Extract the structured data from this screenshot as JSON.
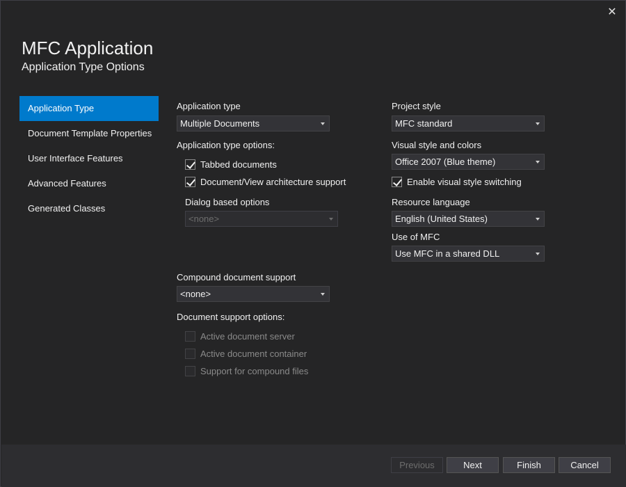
{
  "window": {
    "title": "MFC Application",
    "subtitle": "Application Type Options",
    "close_glyph": "✕"
  },
  "nav": {
    "items": [
      {
        "label": "Application Type"
      },
      {
        "label": "Document Template Properties"
      },
      {
        "label": "User Interface Features"
      },
      {
        "label": "Advanced Features"
      },
      {
        "label": "Generated Classes"
      }
    ]
  },
  "left": {
    "app_type_label": "Application type",
    "app_type_value": "Multiple Documents",
    "app_type_options_label": "Application type options:",
    "tabbed_documents": "Tabbed documents",
    "docview_support": "Document/View architecture support",
    "dialog_options_label": "Dialog based options",
    "dialog_options_value": "<none>",
    "compound_label": "Compound document support",
    "compound_value": "<none>",
    "doc_support_label": "Document support options:",
    "active_doc_server": "Active document server",
    "active_doc_container": "Active document container",
    "compound_files": "Support for compound files"
  },
  "right": {
    "project_style_label": "Project style",
    "project_style_value": "MFC standard",
    "visual_style_label": "Visual style and colors",
    "visual_style_value": "Office 2007 (Blue theme)",
    "visual_switching": "Enable visual style switching",
    "resource_lang_label": "Resource language",
    "resource_lang_value": "English (United States)",
    "use_mfc_label": "Use of MFC",
    "use_mfc_value": "Use MFC in a shared DLL"
  },
  "footer": {
    "previous": "Previous",
    "next": "Next",
    "finish": "Finish",
    "cancel": "Cancel"
  },
  "colors": {
    "accent": "#007acc",
    "background": "#252526",
    "footer": "#2d2d30"
  }
}
